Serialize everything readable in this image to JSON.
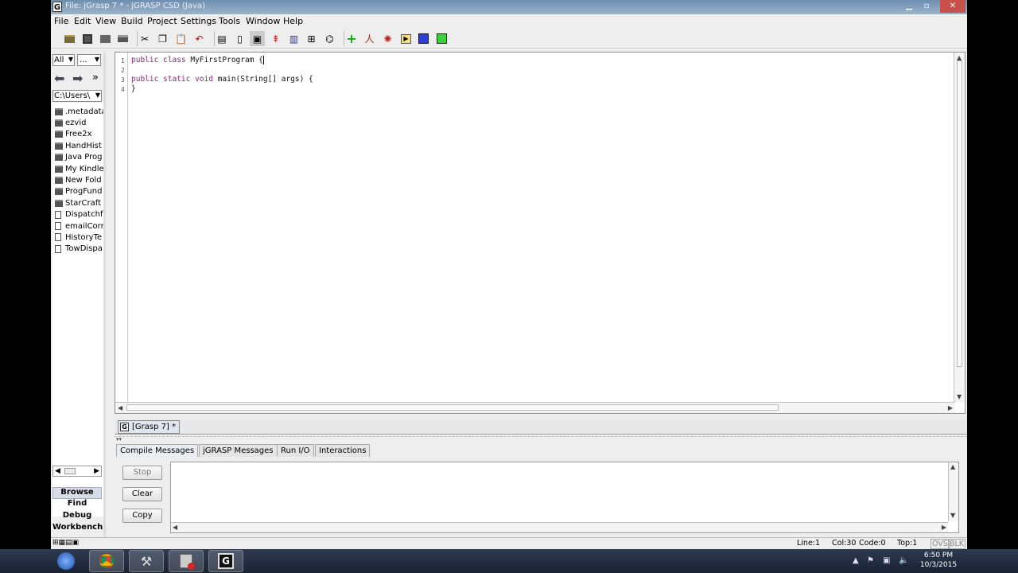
{
  "window": {
    "title": "File: jGrasp 7 * - jGRASP CSD (Java)",
    "controls": [
      "minimize-icon",
      "maximize-icon",
      "close-icon"
    ]
  },
  "menubar": {
    "items": [
      "File",
      "Edit",
      "View",
      "Build",
      "Project",
      "Settings",
      "Tools",
      "Window",
      "Help"
    ]
  },
  "toolbar": {
    "icons": [
      "open-icon",
      "save-icon",
      "folder-icon",
      "print-icon",
      "cut-icon",
      "copy-icon",
      "paste-icon",
      "undo-icon",
      "page-icon",
      "page2-icon",
      "page3-icon",
      "pin-icon",
      "chart-icon",
      "tree-icon",
      "book-icon",
      "compile-plus-icon",
      "run-person-icon",
      "debug-bug-icon",
      "play-icon",
      "stop-blue-icon",
      "green-square-icon"
    ]
  },
  "browser": {
    "filter_value": "All",
    "filter_btn": "...",
    "path_value": "C:\\Users\\",
    "items": [
      {
        "name": ".metadata",
        "type": "folder"
      },
      {
        "name": "ezvid",
        "type": "folder"
      },
      {
        "name": "Free2x",
        "type": "folder"
      },
      {
        "name": "HandHist",
        "type": "folder"
      },
      {
        "name": "Java Prog",
        "type": "folder"
      },
      {
        "name": "My Kindle",
        "type": "folder"
      },
      {
        "name": "New Fold",
        "type": "folder"
      },
      {
        "name": "ProgFund",
        "type": "folder"
      },
      {
        "name": "StarCraft",
        "type": "folder"
      },
      {
        "name": "Dispatchf",
        "type": "file"
      },
      {
        "name": "emailCorr",
        "type": "file"
      },
      {
        "name": "HistoryTe",
        "type": "file"
      },
      {
        "name": "TowDispa",
        "type": "file"
      }
    ],
    "tabs": [
      "Browse",
      "Find",
      "Debug",
      "Workbench"
    ]
  },
  "editor": {
    "lines": [
      {
        "n": "1",
        "kw": "public class",
        "rest": " MyFirstProgram {"
      },
      {
        "n": "2",
        "kw": "",
        "rest": ""
      },
      {
        "n": "3",
        "kw": "public static void",
        "rest": " main(String[] args) {"
      },
      {
        "n": "4",
        "kw": "",
        "rest": "}"
      }
    ]
  },
  "file_tab": {
    "label": "[Grasp 7] *"
  },
  "messages": {
    "tabs": [
      "Compile Messages",
      "jGRASP Messages",
      "Run I/O",
      "Interactions"
    ],
    "active_tab": "Compile Messages",
    "buttons": [
      "Stop",
      "Clear",
      "Copy"
    ],
    "text": ""
  },
  "status": {
    "line": "Line:1",
    "col": "Col:30",
    "code": "Code:0",
    "top": "Top:1",
    "ovs": "OVS",
    "blk": "BLK"
  },
  "taskbar": {
    "apps": [
      "windows-start-icon",
      "chrome-icon",
      "dev-tool-icon",
      "media-icon",
      "jgrasp-icon"
    ],
    "time": "6:50 PM",
    "date": "10/3/2015"
  }
}
